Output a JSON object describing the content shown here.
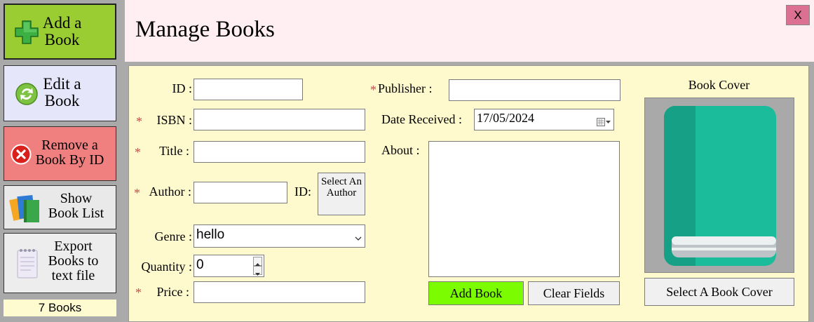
{
  "sidebar": {
    "add_book": "Add a Book",
    "edit_book": "Edit a Book",
    "remove_book": "Remove a Book By ID",
    "show_list": "Show Book List",
    "export": "Export Books to text file",
    "book_count": "7 Books"
  },
  "header": {
    "title": "Manage Books",
    "close": "X"
  },
  "form": {
    "required_mark": "*",
    "id_label": "ID :",
    "id_value": "",
    "isbn_label": "ISBN :",
    "isbn_value": "",
    "title_label": "Title :",
    "title_value": "",
    "author_label": "Author :",
    "author_value": "",
    "author_id_label": "ID:",
    "select_author": "Select An Author",
    "genre_label": "Genre :",
    "genre_value": "hello",
    "quantity_label": "Quantity :",
    "quantity_value": "0",
    "price_label": "Price :",
    "price_value": "",
    "publisher_label": "Publisher :",
    "publisher_value": "",
    "date_label": "Date Received :",
    "date_value": "17/05/2024",
    "about_label": "About :",
    "about_value": "",
    "add_book_button": "Add Book",
    "clear_button": "Clear Fields",
    "cover_label": "Book Cover",
    "select_cover_button": "Select A Book Cover"
  },
  "colors": {
    "add_bg": "#9acd32",
    "edit_bg": "#e6e6fa",
    "remove_bg": "#f08080",
    "header_bg": "#ffeef2",
    "panel_bg": "#fffacd",
    "add_book_btn_bg": "#7cfc00",
    "close_bg": "#db7093",
    "cover_green": "#1abc9c"
  }
}
